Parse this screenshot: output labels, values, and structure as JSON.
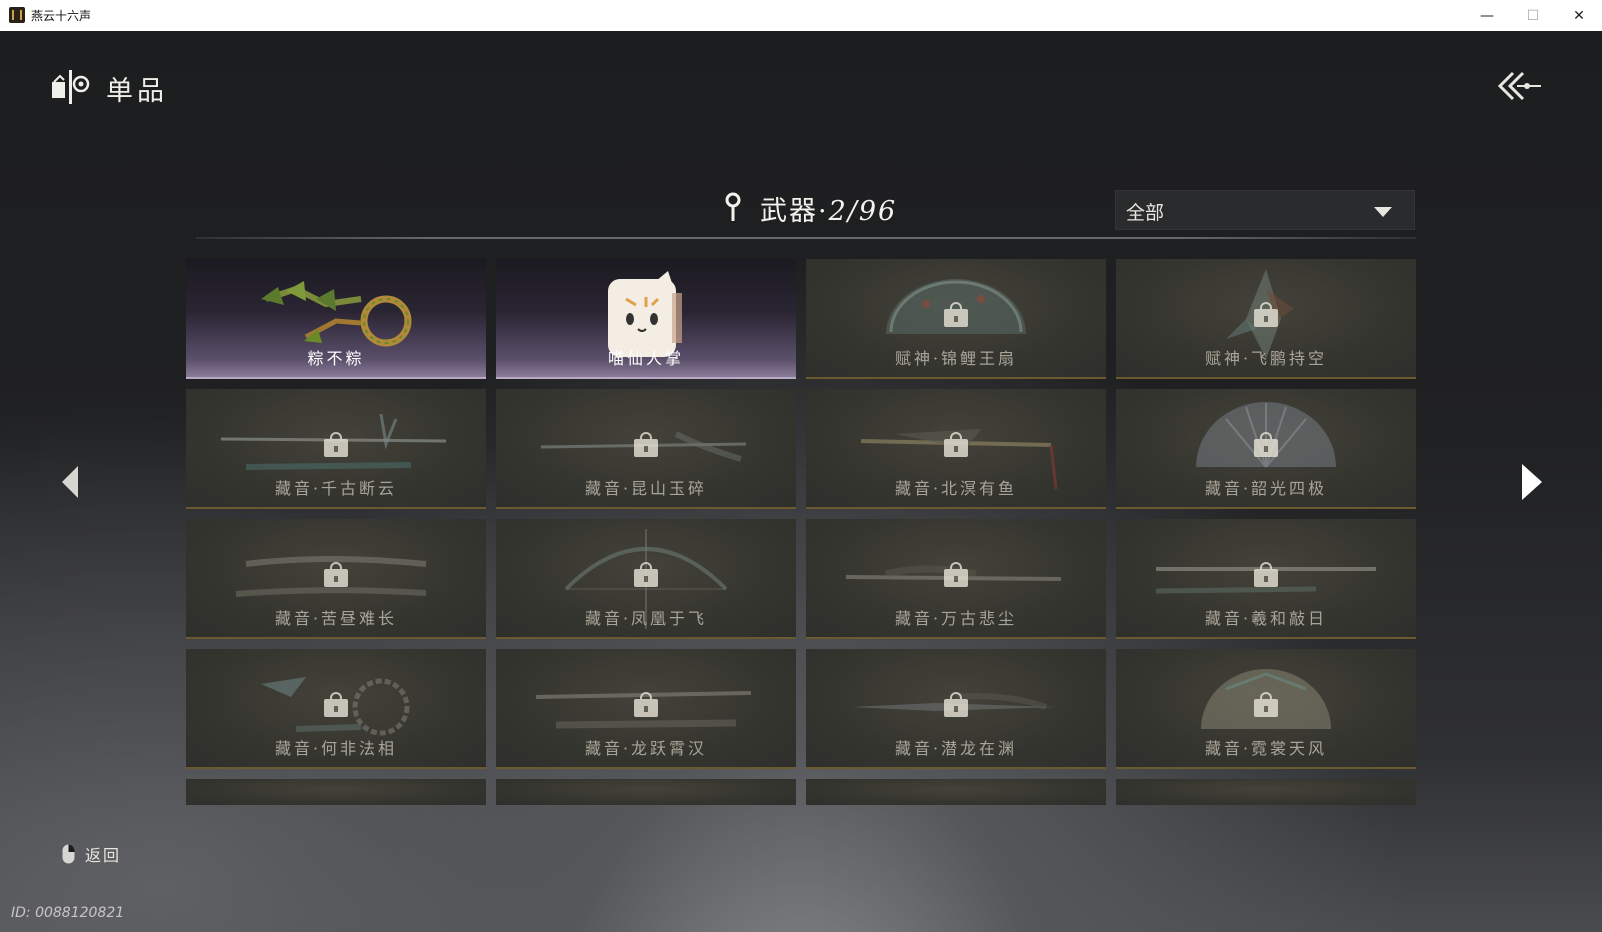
{
  "window": {
    "title": "燕云十六声",
    "minimize": "—",
    "maximize": "☐",
    "close": "✕"
  },
  "header": {
    "title": "单品"
  },
  "category": {
    "name": "武器",
    "separator": "·",
    "count": "2/96"
  },
  "filter": {
    "selected": "全部"
  },
  "items": [
    {
      "name": "粽不粽",
      "owned": true
    },
    {
      "name": "喵仙人掌",
      "owned": true
    },
    {
      "name": "赋神·锦鲤王扇",
      "owned": false
    },
    {
      "name": "赋神·飞鹏持空",
      "owned": false
    },
    {
      "name": "藏音·千古断云",
      "owned": false
    },
    {
      "name": "藏音·昆山玉碎",
      "owned": false
    },
    {
      "name": "藏音·北溟有鱼",
      "owned": false
    },
    {
      "name": "藏音·韶光四极",
      "owned": false
    },
    {
      "name": "藏音·苦昼难长",
      "owned": false
    },
    {
      "name": "藏音·凤凰于飞",
      "owned": false
    },
    {
      "name": "藏音·万古悲尘",
      "owned": false
    },
    {
      "name": "藏音·羲和敲日",
      "owned": false
    },
    {
      "name": "藏音·何非法相",
      "owned": false
    },
    {
      "name": "藏音·龙跃霄汉",
      "owned": false
    },
    {
      "name": "藏音·潜龙在渊",
      "owned": false
    },
    {
      "name": "藏音·霓裳天风",
      "owned": false
    }
  ],
  "footer": {
    "back_label": "返回",
    "uid": "ID: 0088120821"
  },
  "colors": {
    "locked_card": "#363630",
    "owned_card_accent": "#8a7c98",
    "card_border": "#6b5a30"
  }
}
